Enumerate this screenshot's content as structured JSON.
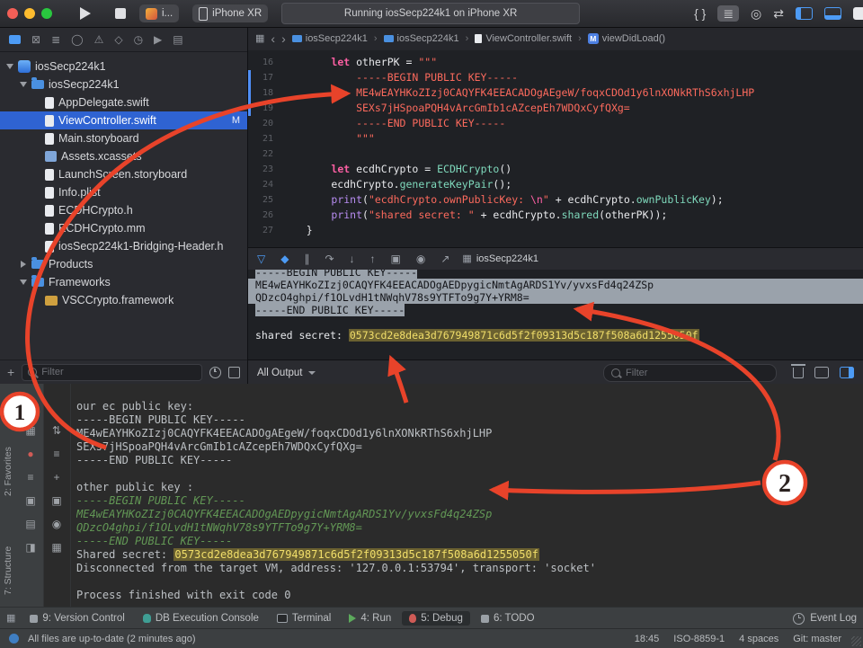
{
  "annotations": {
    "badge1": "1",
    "badge2": "2",
    "color": "#e8432a"
  },
  "icons": {
    "braces": "{ }",
    "editor_lines": "≣",
    "assistant": "◎",
    "version_arrows": "⇄",
    "back": "‹",
    "forward": "›",
    "crumb_sep": "›",
    "related_grid": "▦",
    "plus": "+"
  },
  "xcode": {
    "toolbar": {
      "scheme_label": "i...",
      "destination": "iPhone XR",
      "status": "Running iosSecp224k1 on iPhone XR"
    },
    "navigator": {
      "icon_bar": [
        {
          "name": "project-navigator",
          "glyph": ""
        },
        {
          "name": "source-control-navigator",
          "glyph": "⊠"
        },
        {
          "name": "symbol-navigator",
          "glyph": "≣"
        },
        {
          "name": "find-navigator",
          "glyph": "◯"
        },
        {
          "name": "issue-navigator",
          "glyph": "⚠"
        },
        {
          "name": "test-navigator",
          "glyph": "◇"
        },
        {
          "name": "debug-navigator",
          "glyph": "◷"
        },
        {
          "name": "breakpoint-navigator",
          "glyph": "▶"
        },
        {
          "name": "report-navigator",
          "glyph": "▤"
        }
      ],
      "items": [
        {
          "label": "iosSecp224k1",
          "icon": "project",
          "level": 0,
          "disclosure": "open"
        },
        {
          "label": "iosSecp224k1",
          "icon": "folder",
          "level": 1,
          "disclosure": "open"
        },
        {
          "label": "AppDelegate.swift",
          "icon": "doc",
          "level": 2
        },
        {
          "label": "ViewController.swift",
          "icon": "doc",
          "level": 2,
          "selected": true,
          "badge": "M"
        },
        {
          "label": "Main.storyboard",
          "icon": "doc",
          "level": 2
        },
        {
          "label": "Assets.xcassets",
          "icon": "assets",
          "level": 2
        },
        {
          "label": "LaunchScreen.storyboard",
          "icon": "doc",
          "level": 2
        },
        {
          "label": "Info.plist",
          "icon": "doc",
          "level": 2
        },
        {
          "label": "ECDHCrypto.h",
          "icon": "doc",
          "level": 2
        },
        {
          "label": "ECDHCrypto.mm",
          "icon": "doc",
          "level": 2
        },
        {
          "label": "iosSecp224k1-Bridging-Header.h",
          "icon": "doc",
          "level": 2
        },
        {
          "label": "Products",
          "icon": "folder",
          "level": 1,
          "disclosure": "closed"
        },
        {
          "label": "Frameworks",
          "icon": "folder",
          "level": 1,
          "disclosure": "open"
        },
        {
          "label": "VSCCrypto.framework",
          "icon": "framework",
          "level": 2
        }
      ],
      "filter_placeholder": "Filter"
    },
    "jumpbar": {
      "items": [
        "iosSecp224k1",
        "iosSecp224k1",
        "ViewController.swift",
        "viewDidLoad()"
      ],
      "method_badge": "M"
    },
    "editor": {
      "lines": [
        {
          "n": "16",
          "seg": [
            {
              "c": "plain",
              "t": "        "
            },
            {
              "c": "kw",
              "t": "let"
            },
            {
              "c": "plain",
              "t": " otherPK = "
            },
            {
              "c": "str",
              "t": "\"\"\""
            }
          ]
        },
        {
          "n": "17",
          "seg": [
            {
              "c": "str",
              "t": "            -----BEGIN PUBLIC KEY-----"
            }
          ]
        },
        {
          "n": "18",
          "seg": [
            {
              "c": "str",
              "t": "            ME4wEAYHKoZIzj0CAQYFK4EEACADOgAEgeW/foqxCDOd1y6lnXONkRThS6xhjLHP"
            }
          ]
        },
        {
          "n": "19",
          "seg": [
            {
              "c": "str",
              "t": "            SEXs7jHSpoaPQH4vArcGmIb1cAZcepEh7WDQxCyfQXg="
            }
          ]
        },
        {
          "n": "20",
          "seg": [
            {
              "c": "str",
              "t": "            -----END PUBLIC KEY-----"
            }
          ]
        },
        {
          "n": "21",
          "seg": [
            {
              "c": "str",
              "t": "            \"\"\""
            }
          ]
        },
        {
          "n": "22",
          "seg": []
        },
        {
          "n": "23",
          "seg": [
            {
              "c": "plain",
              "t": "        "
            },
            {
              "c": "kw",
              "t": "let"
            },
            {
              "c": "plain",
              "t": " ecdhCrypto = "
            },
            {
              "c": "type",
              "t": "ECDHCrypto"
            },
            {
              "c": "plain",
              "t": "()"
            }
          ]
        },
        {
          "n": "24",
          "seg": [
            {
              "c": "plain",
              "t": "        ecdhCrypto."
            },
            {
              "c": "member",
              "t": "generateKeyPair"
            },
            {
              "c": "plain",
              "t": "();"
            }
          ]
        },
        {
          "n": "25",
          "seg": [
            {
              "c": "plain",
              "t": "        "
            },
            {
              "c": "call",
              "t": "print"
            },
            {
              "c": "plain",
              "t": "("
            },
            {
              "c": "str",
              "t": "\"ecdhCrypto.ownPublicKey: "
            },
            {
              "c": "esc",
              "t": "\\n"
            },
            {
              "c": "str",
              "t": "\""
            },
            {
              "c": "plain",
              "t": " + ecdhCrypto."
            },
            {
              "c": "member",
              "t": "ownPublicKey"
            },
            {
              "c": "plain",
              "t": ");"
            }
          ]
        },
        {
          "n": "26",
          "seg": [
            {
              "c": "plain",
              "t": "        "
            },
            {
              "c": "call",
              "t": "print"
            },
            {
              "c": "plain",
              "t": "("
            },
            {
              "c": "str",
              "t": "\"shared secret: \""
            },
            {
              "c": "plain",
              "t": " + ecdhCrypto."
            },
            {
              "c": "member",
              "t": "shared"
            },
            {
              "c": "plain",
              "t": "(otherPK));"
            }
          ]
        },
        {
          "n": "27",
          "seg": [
            {
              "c": "plain",
              "t": "    }"
            }
          ]
        }
      ]
    },
    "debugbar": {
      "icons": [
        {
          "name": "hide-debug-area-button",
          "glyph": "▽",
          "blue": true
        },
        {
          "name": "breakpoints-toggle-button",
          "glyph": "◆",
          "blue": true
        },
        {
          "name": "pause-execution-button",
          "glyph": "∥"
        },
        {
          "name": "step-over-button",
          "glyph": "↷"
        },
        {
          "name": "step-into-button",
          "glyph": "↓"
        },
        {
          "name": "step-out-button",
          "glyph": "↑"
        },
        {
          "name": "view-debugger-button",
          "glyph": "▣"
        },
        {
          "name": "memory-graph-button",
          "glyph": "◉"
        },
        {
          "name": "simulate-location-button",
          "glyph": "↗"
        }
      ],
      "target": "iosSecp224k1"
    },
    "console": {
      "lines": [
        {
          "c": "sel-clip",
          "t": "-----BEGIN PUBLIC KEY-----"
        },
        {
          "c": "sel-full",
          "t": "ME4wEAYHKoZIzj0CAQYFK4EEACADOgAEDpygicNmtAgARDS1Yv/yvxsFd4q24ZSp"
        },
        {
          "c": "sel-full",
          "t": "QDzcO4ghpi/f1OLvdH1tNWqhV78s9YTFTo9g7Y+YRM8="
        },
        {
          "c": "sel",
          "t": "-----END PUBLIC KEY-----"
        },
        {
          "c": "blank",
          "t": ""
        },
        {
          "c": "secret",
          "label": "shared secret: ",
          "value": "0573cd2e8dea3d767949871c6d5f2f09313d5c187f508a6d1255050f"
        }
      ]
    },
    "filterbar": {
      "scope": "All Output",
      "filter_placeholder": "Filter"
    }
  },
  "appcode": {
    "stripe": {
      "favorites": "2: Favorites",
      "structure": "7: Structure"
    },
    "debugger_icons_primary": [
      {
        "name": "rerun-button",
        "glyph": "↻"
      },
      {
        "name": "view-options-button",
        "glyph": "▦"
      },
      {
        "name": "stop-button",
        "glyph": "●",
        "red": true
      },
      {
        "name": "console-menu-button",
        "glyph": "≡"
      },
      {
        "name": "restore-layout-button",
        "glyph": "▣"
      },
      {
        "name": "pin-tab-button",
        "glyph": "▤"
      },
      {
        "name": "split-button",
        "glyph": "◨"
      }
    ],
    "debugger_icons_secondary": [
      {
        "name": "sort-button",
        "glyph": "⇅"
      },
      {
        "name": "soft-wrap-button",
        "glyph": "≡"
      },
      {
        "name": "expand-all-button",
        "glyph": "+"
      },
      {
        "name": "print-console-button",
        "glyph": "▣"
      },
      {
        "name": "clear-console-button",
        "glyph": "◉"
      },
      {
        "name": "console-settings-button",
        "glyph": "▦"
      }
    ],
    "console": {
      "lines": [
        {
          "c": "plain",
          "t": "our ec public key:"
        },
        {
          "c": "plain",
          "t": "-----BEGIN PUBLIC KEY-----"
        },
        {
          "c": "plain",
          "t": "ME4wEAYHKoZIzj0CAQYFK4EEACADOgAEgeW/foqxCDOd1y6lnXONkRThS6xhjLHP"
        },
        {
          "c": "plain",
          "t": "SEXs7jHSpoaPQH4vArcGmIb1cAZcepEh7WDQxCyfQXg="
        },
        {
          "c": "plain",
          "t": "-----END PUBLIC KEY-----"
        },
        {
          "c": "blank",
          "t": ""
        },
        {
          "c": "plain",
          "t": "other public key :"
        },
        {
          "c": "green",
          "t": "-----BEGIN PUBLIC KEY-----"
        },
        {
          "c": "green",
          "t": "ME4wEAYHKoZIzj0CAQYFK4EEACADOgAEDpygicNmtAgARDS1Yv/yvxsFd4q24ZSp"
        },
        {
          "c": "green",
          "t": "QDzcO4ghpi/f1OLvdH1tNWqhV78s9YTFTo9g7Y+YRM8="
        },
        {
          "c": "green",
          "t": "-----END PUBLIC KEY-----"
        },
        {
          "c": "secret",
          "label": "Shared secret: ",
          "value": "0573cd2e8dea3d767949871c6d5f2f09313d5c187f508a6d1255050f"
        },
        {
          "c": "plain",
          "t": "Disconnected from the target VM, address: '127.0.0.1:53794', transport: 'socket'"
        },
        {
          "c": "blank",
          "t": ""
        },
        {
          "c": "plain",
          "t": "Process finished with exit code 0"
        }
      ]
    },
    "toolbar": {
      "tabs": [
        {
          "label": "9: Version Control",
          "icon": "vc"
        },
        {
          "label": "DB Execution Console",
          "icon": "db"
        },
        {
          "label": "Terminal",
          "icon": "term"
        },
        {
          "label": "4: Run",
          "icon": "run"
        },
        {
          "label": "5: Debug",
          "icon": "debug",
          "active": true
        },
        {
          "label": "6: TODO",
          "icon": "todo"
        }
      ],
      "event_log": "Event Log"
    },
    "statusbar": {
      "message": "All files are up-to-date (2 minutes ago)",
      "position": "18:45",
      "encoding": "ISO-8859-1",
      "indent": "4 spaces",
      "branch": "Git: master"
    }
  }
}
